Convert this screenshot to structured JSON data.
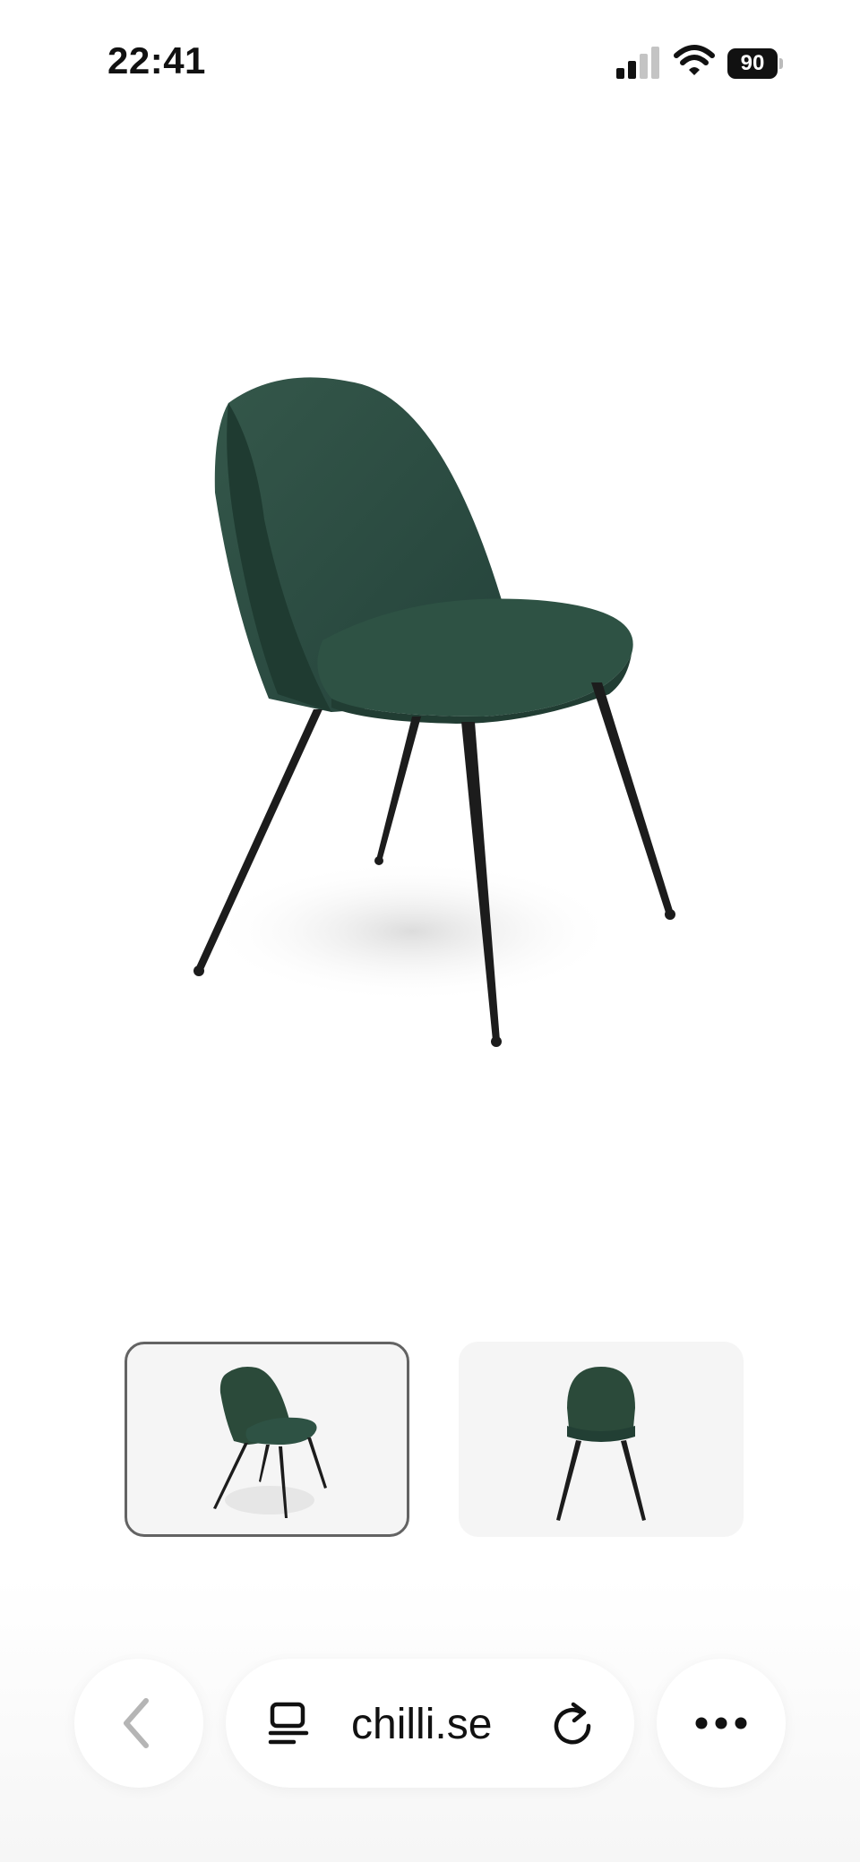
{
  "status_bar": {
    "time": "22:41",
    "battery": "90"
  },
  "product": {
    "main_image": "green-velvet-chair-angle",
    "thumbnails": [
      {
        "image": "green-velvet-chair-angle",
        "selected": true
      },
      {
        "image": "green-velvet-chair-front",
        "selected": false
      }
    ]
  },
  "browser": {
    "url": "chilli.se",
    "back_icon": "chevron-left-icon",
    "reader_icon": "reader-icon",
    "reload_icon": "reload-icon",
    "more_icon": "more-icon"
  },
  "colors": {
    "velvet": "#2b4a3a",
    "legs": "#1c1c1c",
    "thumb_bg": "#f5f5f5"
  }
}
